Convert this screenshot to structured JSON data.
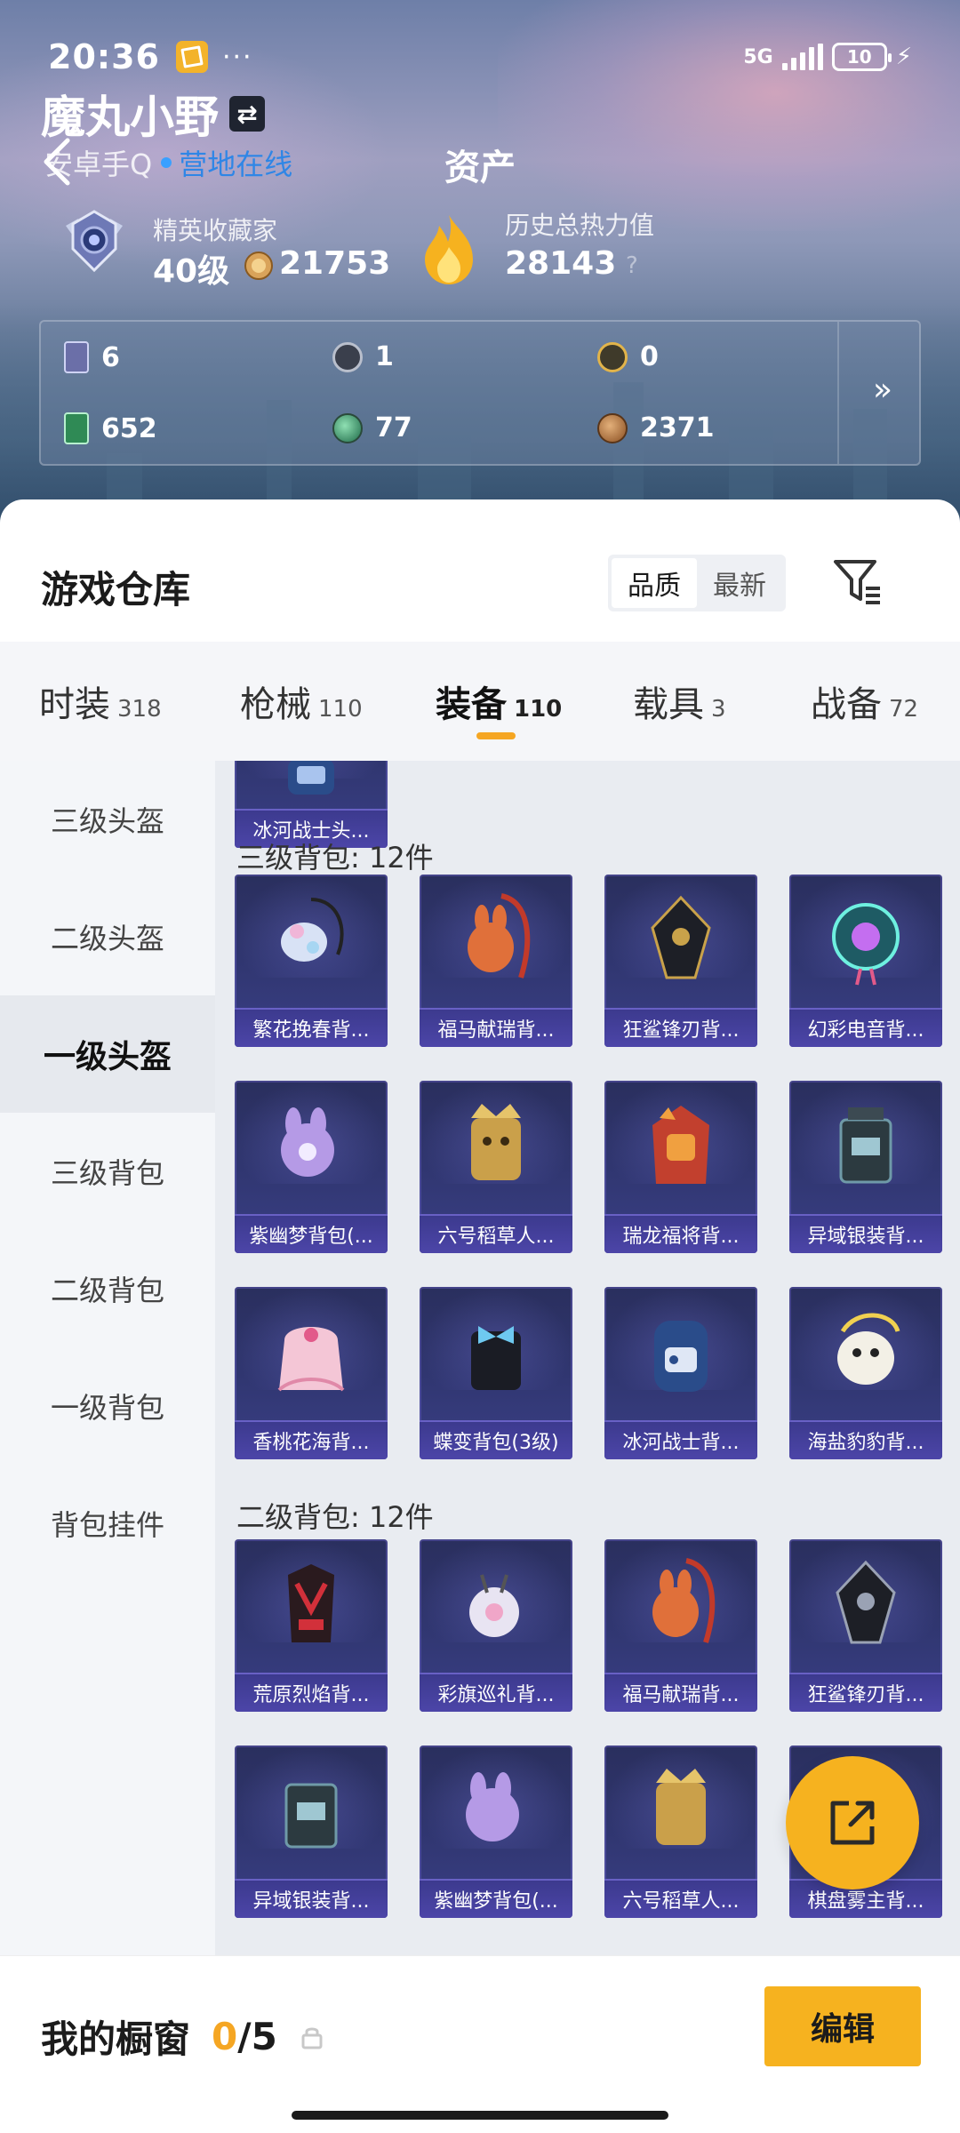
{
  "status_bar": {
    "time": "20:36",
    "more": "···",
    "network": "5G",
    "battery": "10",
    "charging": "⚡"
  },
  "header": {
    "username": "魔丸小野",
    "swap_icon": "⇄",
    "platform": "安卓手Q",
    "online_status": "营地在线",
    "page_title": "资产"
  },
  "rank": {
    "title": "精英收藏家",
    "level": "40级",
    "coins": "21753"
  },
  "heat": {
    "title": "历史总热力值",
    "value": "28143",
    "help": "?"
  },
  "currency": {
    "items": [
      {
        "icon": "card-ticket-icon",
        "value": "6"
      },
      {
        "icon": "silver-token-icon",
        "value": "1"
      },
      {
        "icon": "gold-token-icon",
        "value": "0"
      },
      {
        "icon": "green-card-icon",
        "value": "652"
      },
      {
        "icon": "green-orb-icon",
        "value": "77"
      },
      {
        "icon": "bronze-coin-icon",
        "value": "2371"
      }
    ],
    "more": "»"
  },
  "warehouse": {
    "title": "游戏仓库",
    "sort_options": [
      "品质",
      "最新"
    ],
    "active_sort": "品质"
  },
  "tabs": [
    {
      "label": "时装",
      "count": "318"
    },
    {
      "label": "枪械",
      "count": "110"
    },
    {
      "label": "装备",
      "count": "110"
    },
    {
      "label": "载具",
      "count": "3"
    },
    {
      "label": "战备",
      "count": "72"
    }
  ],
  "active_tab": "装备",
  "sidebar": {
    "items": [
      "三级头盔",
      "二级头盔",
      "一级头盔",
      "三级背包",
      "二级背包",
      "一级背包",
      "背包挂件"
    ],
    "active": "一级头盔"
  },
  "grid": {
    "top_item": "冰河战士头...",
    "sections": [
      {
        "header": "三级背包: 12件",
        "items": [
          "繁花挽春背...",
          "福马献瑞背...",
          "狂鲨锋刃背...",
          "幻彩电音背...",
          "紫幽梦背包(...",
          "六号稻草人...",
          "瑞龙福将背...",
          "异域银装背...",
          "香桃花海背...",
          "蝶变背包(3级)",
          "冰河战士背...",
          "海盐豹豹背..."
        ]
      },
      {
        "header": "二级背包: 12件",
        "items": [
          "荒原烈焰背...",
          "彩旗巡礼背...",
          "福马献瑞背...",
          "狂鲨锋刃背...",
          "异域银装背...",
          "紫幽梦背包(...",
          "六号稻草人...",
          "棋盘雾主背..."
        ]
      }
    ]
  },
  "showcase": {
    "label": "我的橱窗",
    "used": "0",
    "separator": "/",
    "total": "5"
  },
  "edit_label": "编辑",
  "colors": {
    "accent": "#f6b21f",
    "card": "#2f3470",
    "online": "#2f86e6"
  }
}
